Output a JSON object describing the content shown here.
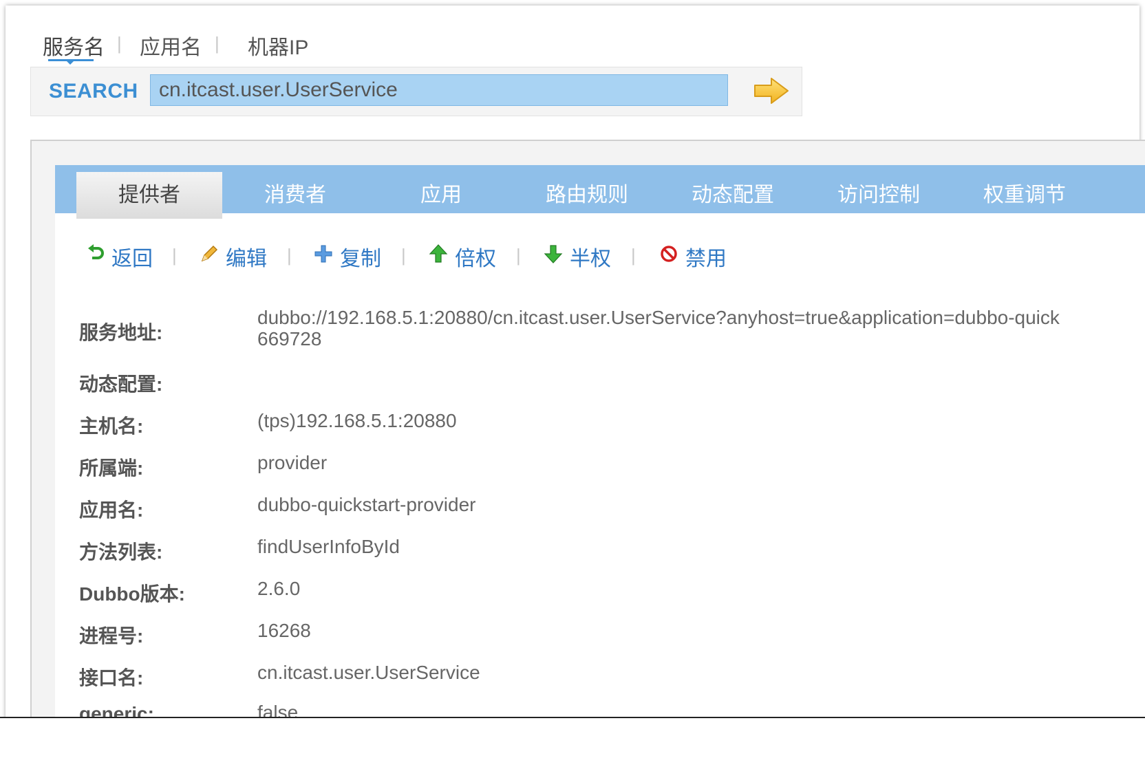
{
  "mode_tabs": [
    "服务名",
    "应用名",
    "机器IP"
  ],
  "search": {
    "label": "SEARCH",
    "value": "cn.itcast.user.UserService"
  },
  "nav_tabs": [
    {
      "label": "提供者",
      "active": true
    },
    {
      "label": "消费者",
      "active": false
    },
    {
      "label": "应用",
      "active": false
    },
    {
      "label": "路由规则",
      "active": false
    },
    {
      "label": "动态配置",
      "active": false
    },
    {
      "label": "访问控制",
      "active": false
    },
    {
      "label": "权重调节",
      "active": false
    }
  ],
  "toolbar": [
    {
      "label": "返回",
      "icon": "return-arrow-icon",
      "color": "#2e9e2e"
    },
    {
      "label": "编辑",
      "icon": "pencil-icon",
      "color": "#e0a020"
    },
    {
      "label": "复制",
      "icon": "plus-icon",
      "color": "#4a90d9"
    },
    {
      "label": "倍权",
      "icon": "arrow-up-icon",
      "color": "#35a835"
    },
    {
      "label": "半权",
      "icon": "arrow-down-icon",
      "color": "#35a835"
    },
    {
      "label": "禁用",
      "icon": "forbidden-icon",
      "color": "#d02020"
    }
  ],
  "details": [
    {
      "label": "服务地址:",
      "value": "dubbo://192.168.5.1:20880/cn.itcast.user.UserService?anyhost=true&application=dubbo-quick",
      "value2": "669728"
    },
    {
      "label": "动态配置:",
      "value": ""
    },
    {
      "label": "主机名:",
      "value": "(tps)192.168.5.1:20880"
    },
    {
      "label": "所属端:",
      "value": "provider"
    },
    {
      "label": "应用名:",
      "value": "dubbo-quickstart-provider"
    },
    {
      "label": "方法列表:",
      "value": "findUserInfoById"
    },
    {
      "label": "Dubbo版本:",
      "value": "2.6.0"
    },
    {
      "label": "进程号:",
      "value": "16268"
    },
    {
      "label": "接口名:",
      "value": "cn.itcast.user.UserService"
    },
    {
      "label": "generic:",
      "value": "false"
    }
  ],
  "colors": {
    "accent": "#3b8fd6",
    "tab_bar": "#8fbfe9",
    "search_input": "#a9d3f3",
    "link": "#2f78c4"
  }
}
